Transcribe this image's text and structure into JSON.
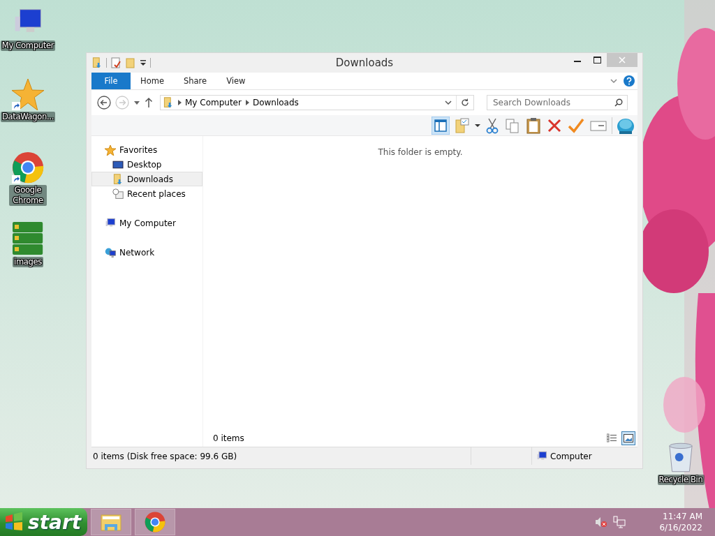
{
  "desktop_icons": [
    {
      "label": "My Computer",
      "kind": "computer"
    },
    {
      "label": "DataWagon...",
      "kind": "star",
      "shortcut": true
    },
    {
      "label": "Google Chrome",
      "kind": "chrome",
      "shortcut": true
    },
    {
      "label": "images",
      "kind": "images",
      "shortcut": false
    },
    {
      "label": "Recycle Bin",
      "kind": "recycle"
    }
  ],
  "window": {
    "title": "Downloads",
    "ribbon_tabs": [
      {
        "label": "File",
        "kind": "menu"
      },
      {
        "label": "Home",
        "kind": "tab"
      },
      {
        "label": "Share",
        "kind": "tab"
      },
      {
        "label": "View",
        "kind": "tab"
      }
    ],
    "navigation": {
      "back_disabled": false,
      "forward_disabled": true
    },
    "address": {
      "crumbs": [
        "My Computer",
        "Downloads"
      ]
    },
    "search": {
      "placeholder": "Search Downloads"
    },
    "nav_pane": [
      {
        "label": "Favorites",
        "kind": "star",
        "selected": false,
        "children": [
          {
            "label": "Desktop",
            "kind": "desktop",
            "selected": false
          },
          {
            "label": "Downloads",
            "kind": "downloads",
            "selected": true
          },
          {
            "label": "Recent places",
            "kind": "recent",
            "selected": false
          }
        ]
      },
      {
        "label": "My Computer",
        "kind": "computer",
        "selected": false
      },
      {
        "label": "Network",
        "kind": "network",
        "selected": false
      }
    ],
    "content": {
      "empty_message": "This folder is empty.",
      "item_count": "0 items"
    },
    "view_buttons": [
      {
        "kind": "details",
        "selected": false
      },
      {
        "kind": "thumbnails",
        "selected": true
      }
    ],
    "status_bar": {
      "text": "0 items (Disk free space: 99.6 GB)",
      "location": "Computer"
    }
  },
  "taskbar": {
    "start": "start",
    "apps": [
      {
        "kind": "explorer"
      },
      {
        "kind": "chrome"
      }
    ],
    "time": "11:47 AM",
    "date": "6/16/2022"
  }
}
